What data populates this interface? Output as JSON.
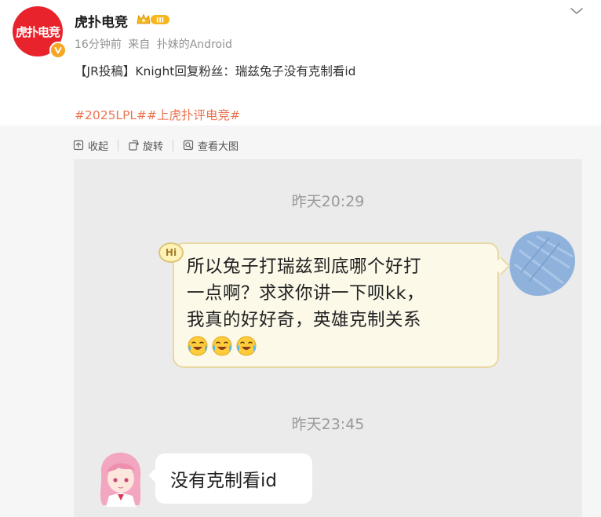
{
  "post": {
    "author": {
      "name": "虎扑电竞",
      "avatar_text": "虎扑电竞",
      "member_badge": "III",
      "verified_icon": "verified-v-icon",
      "brand_color": "#e8232c"
    },
    "meta": {
      "time": "16分钟前",
      "source_prefix": "来自",
      "source": "扑妹的Android"
    },
    "text": "【JR投稿】Knight回复粉丝：瑞兹兔子没有克制看id",
    "hashtags": [
      "#2025LPL#",
      "#上虎扑评电竞#"
    ],
    "hashtag_color": "#eb7350"
  },
  "image_toolbar": {
    "collapse_label": "收起",
    "rotate_label": "旋转",
    "view_large_label": "查看大图"
  },
  "chat": {
    "messages": [
      {
        "time": "昨天20:29",
        "side": "right",
        "sticker_text": "Hi",
        "lines": [
          "所以兔子打瑞兹到底哪个好打",
          "一点啊？求求你讲一下呗kk，",
          "我真的好好奇，英雄克制关系"
        ],
        "emoji": [
          "crying-laughing-emoji",
          "crying-laughing-emoji",
          "crying-laughing-emoji"
        ]
      },
      {
        "time": "昨天23:45",
        "side": "left",
        "lines": [
          "没有克制看id"
        ]
      }
    ]
  }
}
